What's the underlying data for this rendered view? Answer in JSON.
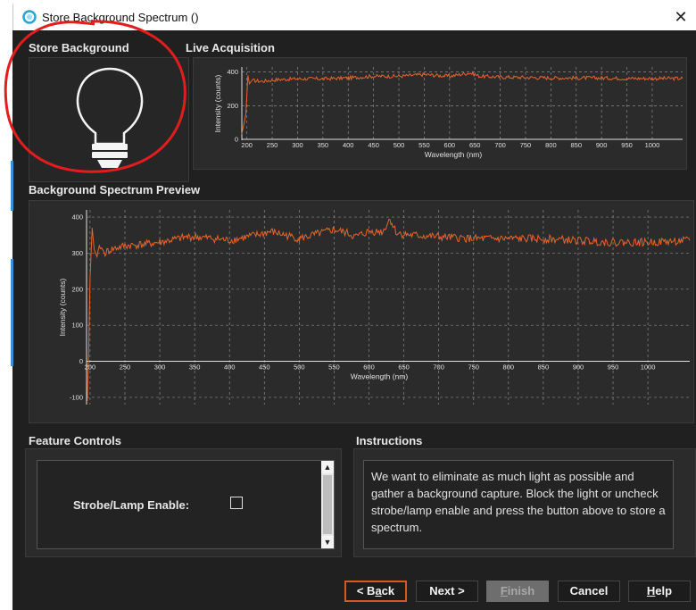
{
  "window": {
    "title": "Store Background Spectrum ()",
    "close_glyph": "✕"
  },
  "store_background": {
    "title": "Store Background",
    "icon": "light-bulb-icon"
  },
  "live_acquisition": {
    "title": "Live Acquisition",
    "chart_data": {
      "type": "line",
      "xlabel": "Wavelength (nm)",
      "ylabel": "Intensity (counts)",
      "xlim": [
        190,
        1060
      ],
      "ylim": [
        -5,
        430
      ],
      "x_ticks": [
        200,
        250,
        300,
        350,
        400,
        450,
        500,
        550,
        600,
        650,
        700,
        750,
        800,
        850,
        900,
        950,
        1000
      ],
      "y_ticks": [
        0,
        200,
        400
      ],
      "series": [
        {
          "color": "#e8632a",
          "x": [
            190,
            198,
            202,
            205,
            210,
            230,
            260,
            300,
            350,
            400,
            450,
            500,
            550,
            600,
            640,
            650,
            660,
            700,
            750,
            800,
            850,
            900,
            950,
            1000,
            1060
          ],
          "y": [
            30,
            150,
            380,
            330,
            350,
            345,
            355,
            360,
            360,
            365,
            375,
            375,
            385,
            375,
            395,
            385,
            375,
            370,
            368,
            365,
            365,
            365,
            362,
            362,
            362
          ]
        }
      ],
      "grid": true
    }
  },
  "preview": {
    "title": "Background Spectrum Preview",
    "chart_data": {
      "type": "line",
      "xlabel": "Wavelength (nm)",
      "ylabel": "Intensity (counts)",
      "xlim": [
        195,
        1060
      ],
      "ylim": [
        -120,
        420
      ],
      "x_ticks": [
        200,
        250,
        300,
        350,
        400,
        450,
        500,
        550,
        600,
        650,
        700,
        750,
        800,
        850,
        900,
        950,
        1000
      ],
      "y_ticks": [
        -100,
        0,
        100,
        200,
        300,
        400
      ],
      "series": [
        {
          "color": "#e8632a",
          "x": [
            196,
            198,
            200,
            203,
            206,
            210,
            215,
            220,
            230,
            250,
            280,
            300,
            340,
            350,
            380,
            400,
            450,
            460,
            500,
            540,
            550,
            570,
            580,
            600,
            620,
            630,
            640,
            660,
            700,
            750,
            800,
            850,
            900,
            950,
            1000,
            1060
          ],
          "y": [
            -110,
            20,
            230,
            370,
            310,
            290,
            320,
            300,
            310,
            320,
            325,
            330,
            345,
            345,
            340,
            335,
            355,
            360,
            340,
            360,
            365,
            355,
            345,
            360,
            360,
            395,
            355,
            350,
            345,
            340,
            340,
            340,
            335,
            330,
            330,
            335
          ]
        }
      ],
      "grid": true
    }
  },
  "feature_controls": {
    "title": "Feature Controls",
    "strobe_label": "Strobe/Lamp Enable:",
    "strobe_checked": false
  },
  "instructions": {
    "title": "Instructions",
    "text": "We want to eliminate as much light as possible and gather a background capture. Block the light or uncheck strobe/lamp enable and press the button above to store a spectrum."
  },
  "buttons": {
    "back_mn": "<",
    "back_rest": " B",
    "back_u": "a",
    "back_end": "ck",
    "next": "Next >",
    "finish_u": "F",
    "finish_rest": "inish",
    "cancel": "Cancel",
    "help_u": "H",
    "help_rest": "elp"
  },
  "colors": {
    "accent": "#d6591f",
    "trace": "#e8632a",
    "annotation": "#e21d1d"
  }
}
